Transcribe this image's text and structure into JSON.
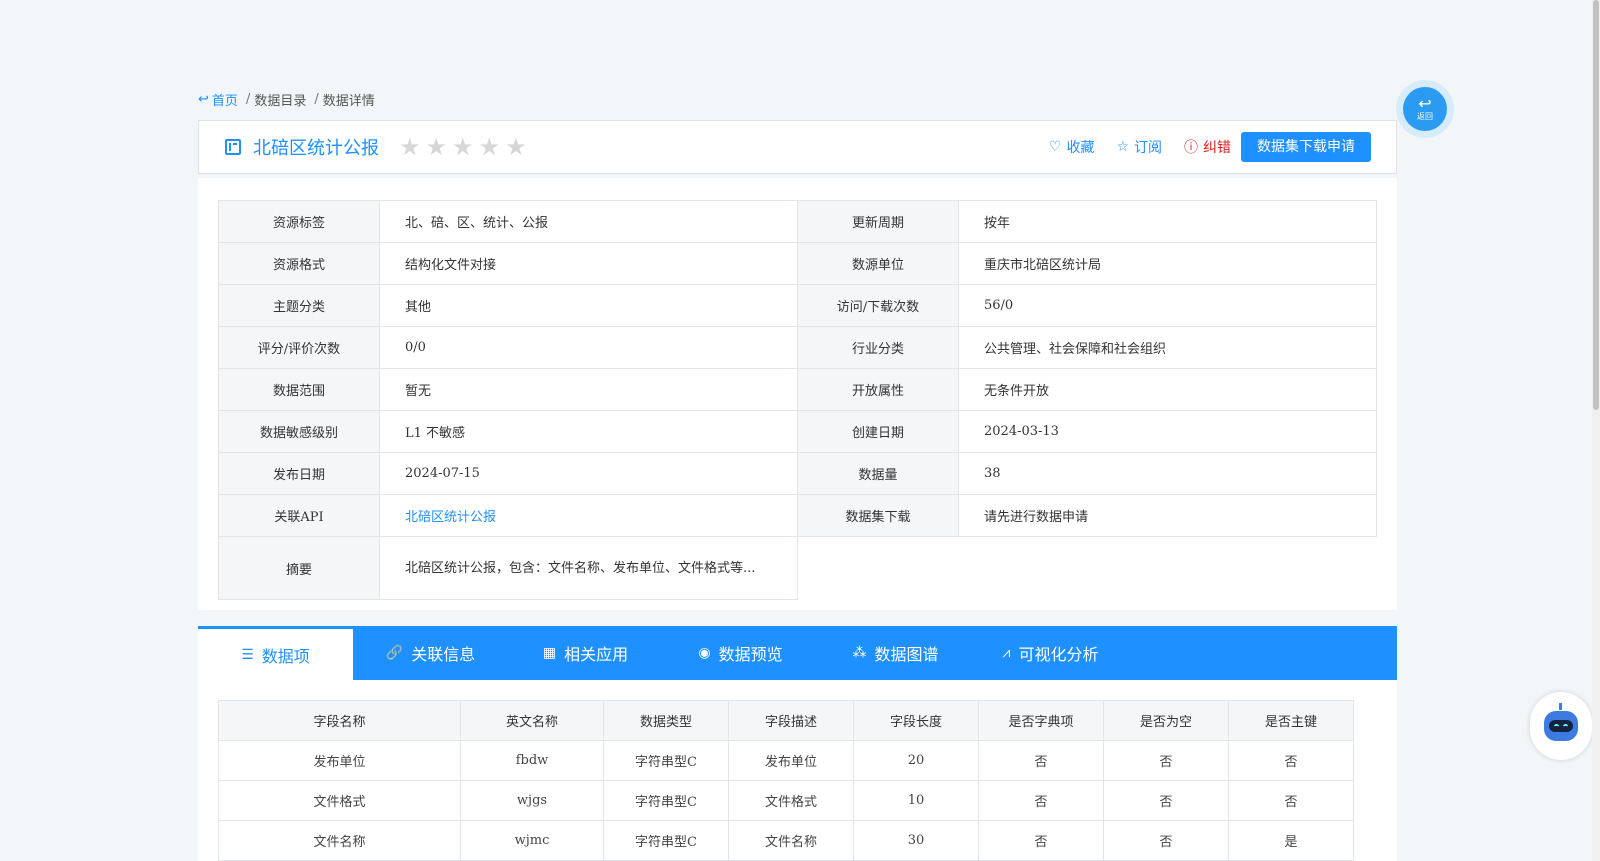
{
  "breadcrumb": {
    "home": "首页",
    "catalog": "数据目录",
    "current": "数据详情",
    "sep": "/"
  },
  "header": {
    "title": "北碚区统计公报",
    "stars": 5,
    "favorite": "收藏",
    "subscribe": "订阅",
    "report": "纠错",
    "download_btn": "数据集下载申请"
  },
  "info": {
    "rows": [
      {
        "k1": "资源标签",
        "v1": "北、碚、区、统计、公报",
        "k2": "更新周期",
        "v2": "按年"
      },
      {
        "k1": "资源格式",
        "v1": "结构化文件对接",
        "k2": "数源单位",
        "v2": "重庆市北碚区统计局"
      },
      {
        "k1": "主题分类",
        "v1": "其他",
        "k2": "访问/下载次数",
        "v2": "56/0"
      },
      {
        "k1": "评分/评价次数",
        "v1": "0/0",
        "k2": "行业分类",
        "v2": "公共管理、社会保障和社会组织"
      },
      {
        "k1": "数据范围",
        "v1": "暂无",
        "k2": "开放属性",
        "v2": "无条件开放"
      },
      {
        "k1": "数据敏感级别",
        "v1": "L1 不敏感",
        "k2": "创建日期",
        "v2": "2024-03-13"
      },
      {
        "k1": "发布日期",
        "v1": "2024-07-15",
        "k2": "数据量",
        "v2": "38"
      },
      {
        "k1": "关联API",
        "v1": "北碚区统计公报",
        "k2": "数据集下载",
        "v2": "请先进行数据申请"
      }
    ],
    "summary_label": "摘要",
    "summary_text": "北碚区统计公报，包含：文件名称、发布单位、文件格式等..."
  },
  "tabs": [
    {
      "label": "数据项",
      "icon": "list-icon",
      "glyph": "☰"
    },
    {
      "label": "关联信息",
      "icon": "link-icon",
      "glyph": "🔗"
    },
    {
      "label": "相关应用",
      "icon": "grid-icon",
      "glyph": "▦"
    },
    {
      "label": "数据预览",
      "icon": "eye-icon",
      "glyph": "◉"
    },
    {
      "label": "数据图谱",
      "icon": "graph-icon",
      "glyph": "⁂"
    },
    {
      "label": "可视化分析",
      "icon": "chart-icon",
      "glyph": "⩘"
    }
  ],
  "fields": {
    "headers": [
      "字段名称",
      "英文名称",
      "数据类型",
      "字段描述",
      "字段长度",
      "是否字典项",
      "是否为空",
      "是否主键"
    ],
    "rows": [
      [
        "发布单位",
        "fbdw",
        "字符串型C",
        "发布单位",
        "20",
        "否",
        "否",
        "否"
      ],
      [
        "文件格式",
        "wjgs",
        "字符串型C",
        "文件格式",
        "10",
        "否",
        "否",
        "否"
      ],
      [
        "文件名称",
        "wjmc",
        "字符串型C",
        "文件名称",
        "30",
        "否",
        "否",
        "是"
      ]
    ]
  },
  "back_button": "返回",
  "colors": {
    "accent": "#1e90ff",
    "danger": "#e02020"
  }
}
